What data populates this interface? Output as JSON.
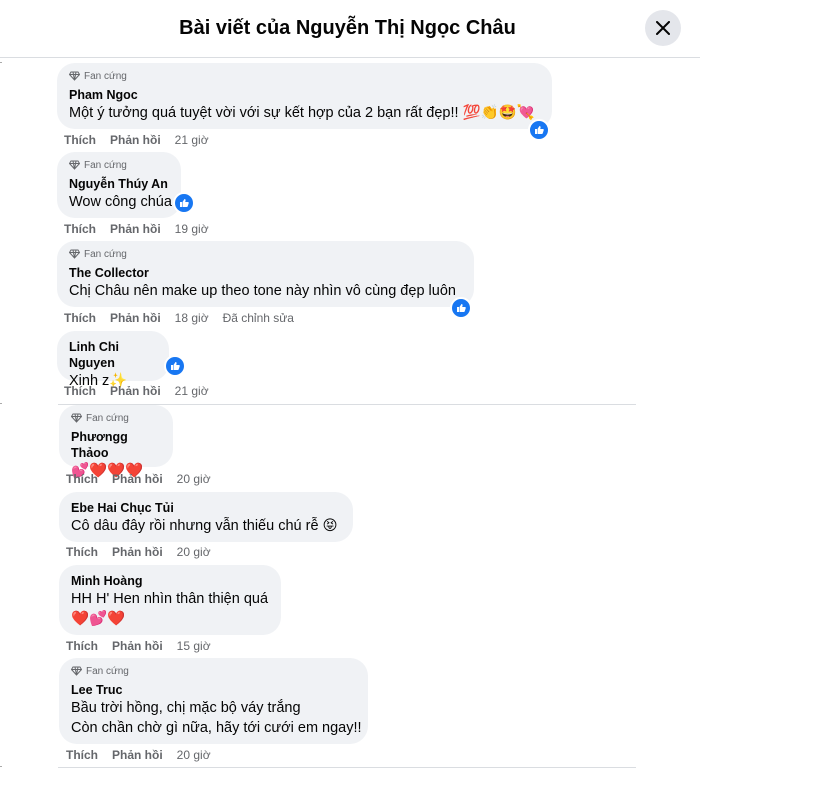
{
  "header": {
    "title": "Bài viết của Nguyễn Thị Ngọc Châu"
  },
  "labels": {
    "like": "Thích",
    "reply": "Phản hồi"
  },
  "comments": [
    {
      "badge": "Fan cứng",
      "author": "Pham Ngoc",
      "text": "Một ý tưởng quá tuyệt vời với sự kết hợp của 2 bạn rất đẹp!! 💯👏🤩💘",
      "time": "21 giờ"
    },
    {
      "badge": "Fan cứng",
      "author": "Nguyễn Thúy An",
      "text": "Wow công chúa",
      "time": "19 giờ"
    },
    {
      "badge": "Fan cứng",
      "author": "The Collector",
      "text": "Chị Châu nên make up theo tone này nhìn vô cùng đẹp luôn",
      "time": "18 giờ",
      "edited": "Đã chỉnh sửa"
    },
    {
      "author": "Linh Chi Nguyen",
      "text": "Xinh z✨",
      "time": "21 giờ"
    },
    {
      "badge": "Fan cứng",
      "author": "Phươngg Thảoo",
      "text": "💕❤️❤️❤️",
      "time": "20 giờ"
    },
    {
      "author": "Ebe Hai Chục Tủi",
      "text": "Cô dâu đây rồi nhưng vẫn thiếu chú rễ 😝",
      "time": "20 giờ"
    },
    {
      "author": "Minh Hoàng",
      "text": "HH H' Hen nhìn thân thiện quá",
      "text2": "❤️💕❤️",
      "time": "15 giờ"
    },
    {
      "badge": "Fan cứng",
      "author": "Lee Truc",
      "text": "Bầu trời hồng, chị mặc bộ váy trắng",
      "text2": "Còn chần chờ gì nữa, hãy tới cưới em ngay!!",
      "time": "20 giờ"
    }
  ]
}
